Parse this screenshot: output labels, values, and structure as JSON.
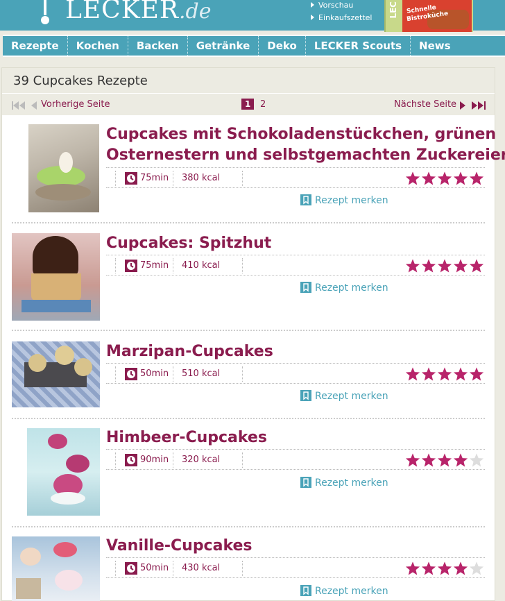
{
  "header": {
    "logo": "LECKER",
    "logo_tld": ".de",
    "links": [
      "Vorschau",
      "Einkaufszettel"
    ],
    "magazine": {
      "spine": "LEC",
      "line1": "Schnelle",
      "line2": "Bistroküche"
    }
  },
  "nav": [
    "Rezepte",
    "Kochen",
    "Backen",
    "Getränke",
    "Deko",
    "LECKER Scouts",
    "News"
  ],
  "results": {
    "title": "39 Cupcakes Rezepte",
    "prev": "Vorherige Seite",
    "next": "Nächste Seite",
    "pages": [
      "1",
      "2"
    ],
    "current_page": "1"
  },
  "recipes": [
    {
      "title_lines": [
        "Cupcakes mit Schokoladenstückchen, grünen",
        "Osternestern und selbstgemachten Zuckereiern"
      ],
      "time": "75min",
      "kcal": "380 kcal",
      "rating": 5,
      "save": "Rezept merken"
    },
    {
      "title_lines": [
        "Cupcakes: Spitzhut"
      ],
      "time": "75min",
      "kcal": "410 kcal",
      "rating": 5,
      "save": "Rezept merken"
    },
    {
      "title_lines": [
        "Marzipan-Cupcakes"
      ],
      "time": "50min",
      "kcal": "510 kcal",
      "rating": 5,
      "save": "Rezept merken"
    },
    {
      "title_lines": [
        "Himbeer-Cupcakes"
      ],
      "time": "90min",
      "kcal": "320 kcal",
      "rating": 4,
      "save": "Rezept merken"
    },
    {
      "title_lines": [
        "Vanille-Cupcakes"
      ],
      "time": "50min",
      "kcal": "430 kcal",
      "rating": 4,
      "save": "Rezept merken"
    }
  ],
  "colors": {
    "brand": "#4aa3b8",
    "accent": "#8a1c4e",
    "star_on": "#b8246a",
    "star_off": "#dddddd"
  }
}
